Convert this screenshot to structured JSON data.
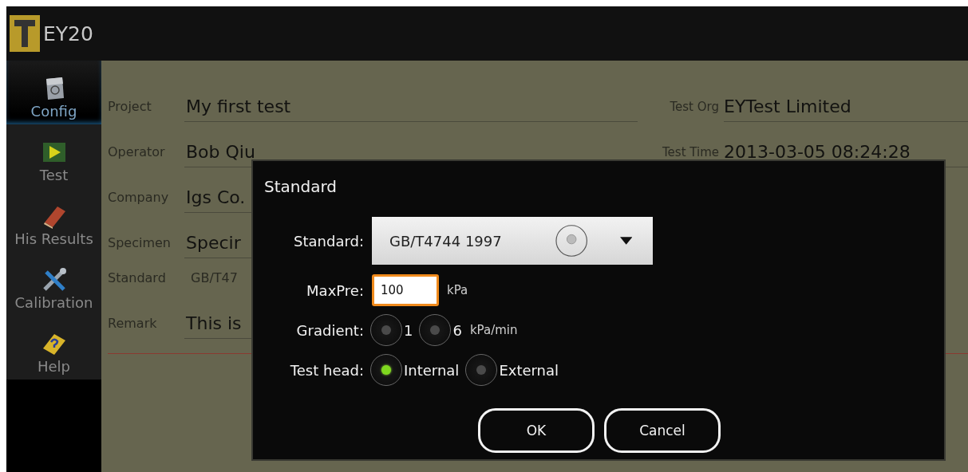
{
  "app_bar": {
    "title": "EY20"
  },
  "sidebar": {
    "items": [
      {
        "label": "Config",
        "selected": true
      },
      {
        "label": "Test",
        "selected": false
      },
      {
        "label": "His Results",
        "selected": false
      },
      {
        "label": "Calibration",
        "selected": false
      },
      {
        "label": "Help",
        "selected": false
      }
    ]
  },
  "form": {
    "left_fields": [
      {
        "label": "Project",
        "value": "My first test",
        "kind": "input"
      },
      {
        "label": "Operator",
        "value": "Bob Qiu",
        "kind": "input"
      },
      {
        "label": "Company",
        "value": "Igs Co.",
        "kind": "input"
      },
      {
        "label": "Specimen",
        "value": "Specir",
        "kind": "input"
      },
      {
        "label": "Standard",
        "value": "GB/T47",
        "kind": "text"
      },
      {
        "label": "Remark",
        "value": "This is",
        "kind": "input"
      }
    ],
    "right_fields": [
      {
        "label": "Test Org",
        "value": "EYTest Limited",
        "kind": "input"
      },
      {
        "label": "Test Time",
        "value": "2013-03-05 08:24:28",
        "kind": "input"
      }
    ]
  },
  "dialog": {
    "title": "Standard",
    "standard": {
      "label": "Standard:",
      "value": "GB/T4744 1997"
    },
    "max_pressure": {
      "label": "MaxPre:",
      "value": "100",
      "unit": "kPa",
      "focused": true
    },
    "gradient": {
      "label": "Gradient:",
      "unit": "kPa/min",
      "options": [
        {
          "label": "1",
          "selected": false
        },
        {
          "label": "6",
          "selected": false
        }
      ]
    },
    "test_head": {
      "label": "Test head:",
      "options": [
        {
          "label": "Internal",
          "selected": true
        },
        {
          "label": "External",
          "selected": false
        }
      ]
    },
    "buttons": [
      "OK",
      "Cancel"
    ]
  }
}
